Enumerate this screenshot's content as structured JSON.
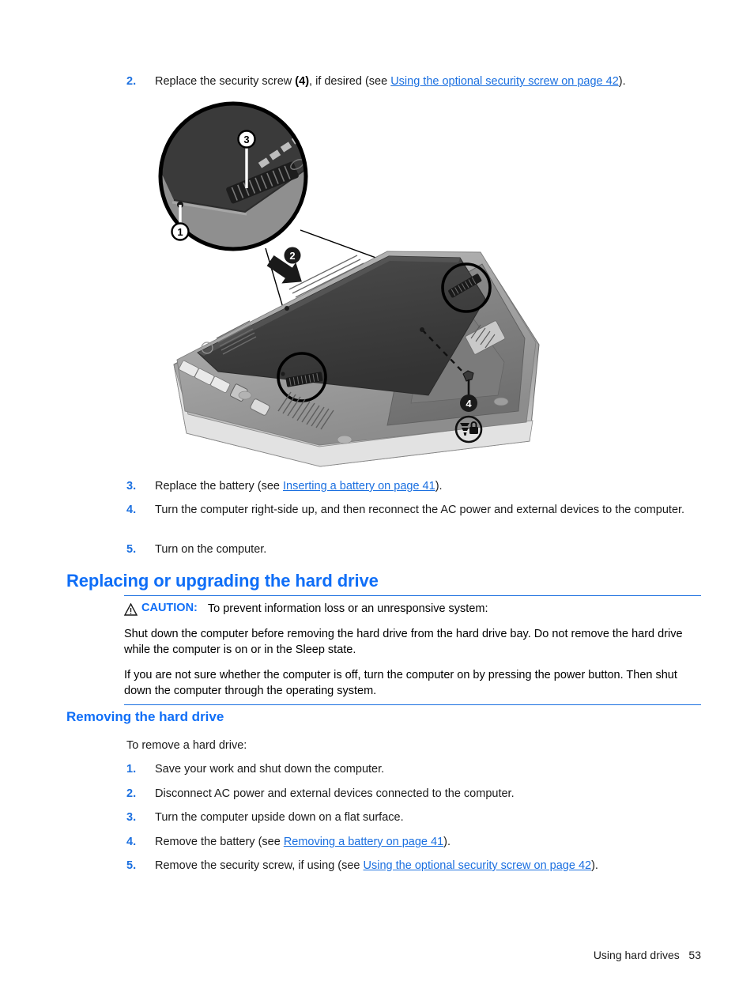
{
  "page": {
    "footer_section": "Using hard drives",
    "footer_page_number": "53",
    "accent_blue": "#0f6ef7",
    "link_blue": "#1a6fe0"
  },
  "steps_top": [
    {
      "num": "2.",
      "text_before": "Replace the security screw ",
      "bold": "(4)",
      "text_mid": ", if desired (see ",
      "link": "Using the optional security screw on page 42",
      "text_after": ")."
    },
    {
      "num": "3.",
      "text_before": "Replace the battery (see ",
      "link": "Inserting a battery on page 41",
      "text_after": ")."
    },
    {
      "num": "4.",
      "text_before": "Turn the computer right-side up, and then reconnect the AC power and external devices to the computer."
    },
    {
      "num": "5.",
      "text_before": "Turn on the computer."
    }
  ],
  "figure": {
    "caption_alt": "Bottom view of notebook computer showing service cover latch, cover removal direction, and optional security screw",
    "callouts": [
      {
        "id": "1",
        "meaning": "security-screw-hole"
      },
      {
        "id": "2",
        "meaning": "cover-slide-direction"
      },
      {
        "id": "3",
        "meaning": "service-cover-release-latch"
      },
      {
        "id": "4",
        "meaning": "optional-security-screw"
      }
    ],
    "lock_icon_label": "security-cable-lock-icon"
  },
  "section_main": {
    "heading": "Replacing or upgrading the hard drive"
  },
  "caution": {
    "label": "CAUTION:",
    "lead": "To prevent information loss or an unresponsive system:",
    "para1": "Shut down the computer before removing the hard drive from the hard drive bay. Do not remove the hard drive while the computer is on or in the Sleep state.",
    "para2": "If you are not sure whether the computer is off, turn the computer on by pressing the power button. Then shut down the computer through the operating system."
  },
  "section_sub": {
    "heading": "Removing the hard drive",
    "intro": "To remove a hard drive:"
  },
  "steps_bottom": [
    {
      "num": "1.",
      "text_before": "Save your work and shut down the computer."
    },
    {
      "num": "2.",
      "text_before": "Disconnect AC power and external devices connected to the computer."
    },
    {
      "num": "3.",
      "text_before": "Turn the computer upside down on a flat surface."
    },
    {
      "num": "4.",
      "text_before": "Remove the battery (see ",
      "link": "Removing a battery on page 41",
      "text_after": ")."
    },
    {
      "num": "5.",
      "text_before": "Remove the security screw, if using (see ",
      "link": "Using the optional security screw on page 42",
      "text_after": ")."
    }
  ]
}
